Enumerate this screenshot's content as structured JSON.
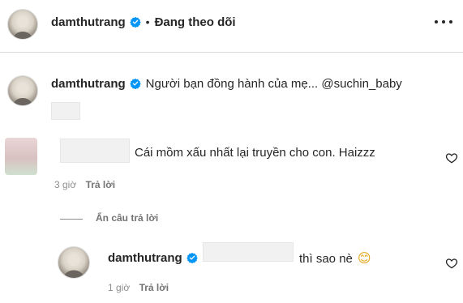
{
  "header": {
    "username": "damthutrang",
    "separator": "•",
    "follow_status": "Đang theo dõi",
    "more_icon": "more-horizontal-icon",
    "verified_icon": "verified-badge-icon"
  },
  "caption": {
    "username": "damthutrang",
    "text": "Người bạn đồng hành của mẹ... @suchin_baby"
  },
  "comment": {
    "text": "Cái mồm xấu nhất lại truyền cho con. Haizzz",
    "time": "3 giờ",
    "reply_label": "Trả lời",
    "like_icon": "heart-outline-icon"
  },
  "hide_replies": {
    "label": "Ẩn câu trả lời"
  },
  "reply": {
    "username": "damthutrang",
    "text": "thì sao nè",
    "emoji": "😊",
    "time": "1 giờ",
    "reply_label": "Trả lời",
    "like_icon": "heart-outline-icon"
  },
  "colors": {
    "verified": "#0095f6",
    "text": "#262626",
    "muted": "#8e8e8e"
  }
}
